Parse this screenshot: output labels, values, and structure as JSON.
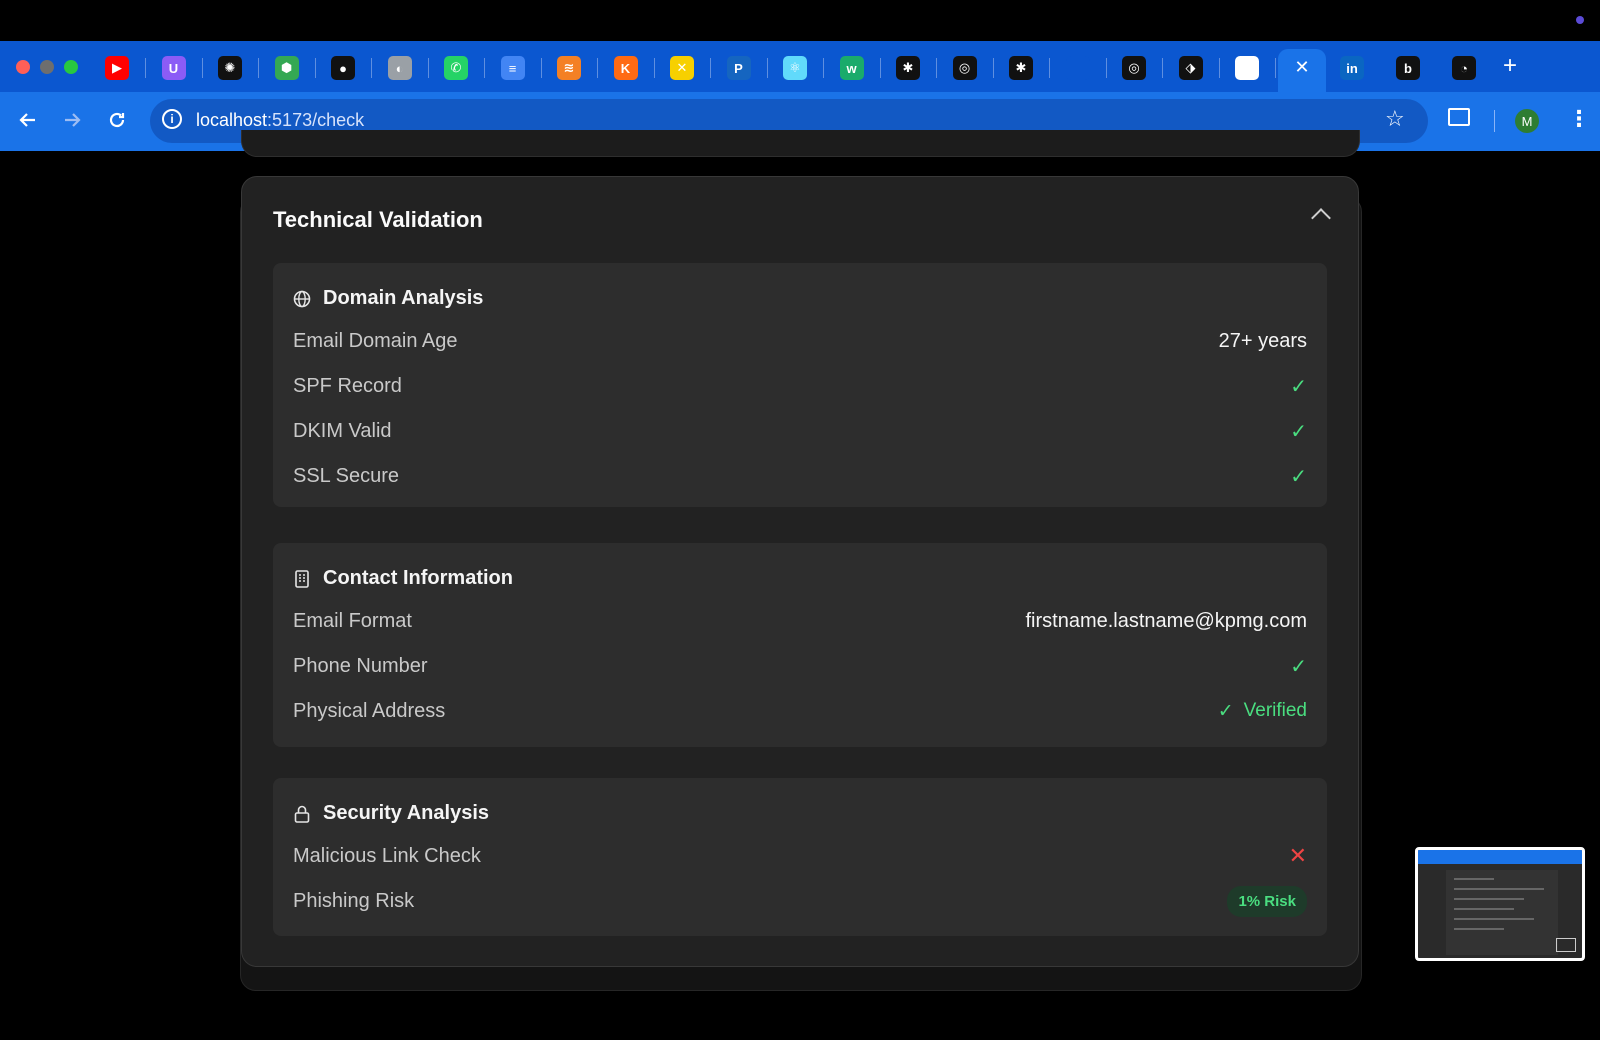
{
  "browser": {
    "active_tab_close": "✕",
    "new_tab": "+",
    "url_host": "localhost",
    "url_path": ":5173/check",
    "avatar_initial": "M",
    "tab_icons": [
      {
        "name": "youtube-icon",
        "glyph": "▶",
        "color": "#ff0000"
      },
      {
        "name": "u-app-icon",
        "glyph": "U",
        "color": "#8b5cf6"
      },
      {
        "name": "openai-icon",
        "glyph": "✺",
        "color": "#111111"
      },
      {
        "name": "cube-icon",
        "glyph": "⬢",
        "color": "#34a853"
      },
      {
        "name": "github-icon",
        "glyph": "●",
        "color": "#111111"
      },
      {
        "name": "globe-icon",
        "glyph": "◐",
        "color": "#9aa0a6"
      },
      {
        "name": "whatsapp-icon",
        "glyph": "✆",
        "color": "#25d366"
      },
      {
        "name": "docs-icon",
        "glyph": "≡",
        "color": "#4285f4"
      },
      {
        "name": "stack-icon",
        "glyph": "≋",
        "color": "#f48024"
      },
      {
        "name": "k-app-icon",
        "glyph": "K",
        "color": "#ff6a13"
      },
      {
        "name": "yellow-app-icon",
        "glyph": "✕",
        "color": "#f7d000"
      },
      {
        "name": "p-app-icon",
        "glyph": "P",
        "color": "#1565c0"
      },
      {
        "name": "react-icon",
        "glyph": "⚛",
        "color": "#61dafb"
      },
      {
        "name": "w-app-icon",
        "glyph": "w",
        "color": "#1aab6b"
      },
      {
        "name": "perplexity-icon",
        "glyph": "✱",
        "color": "#111111"
      },
      {
        "name": "ring-icon",
        "glyph": "◎",
        "color": "#111111"
      },
      {
        "name": "perplexity-icon-2",
        "glyph": "✱",
        "color": "#111111"
      },
      {
        "name": "blank-tab-icon",
        "glyph": "",
        "color": "#0b57d0"
      },
      {
        "name": "ring-icon-2",
        "glyph": "◎",
        "color": "#111111"
      },
      {
        "name": "shirt-app-icon",
        "glyph": "⬗",
        "color": "#111111"
      },
      {
        "name": "chrome-icon",
        "glyph": "◉",
        "color": "#ffffff"
      }
    ],
    "tab_icons_right": [
      {
        "name": "linkedin-icon",
        "glyph": "in",
        "color": "#0a66c2"
      },
      {
        "name": "b-app-icon",
        "glyph": "b",
        "color": "#111111"
      },
      {
        "name": "swirl-app-icon",
        "glyph": "◔",
        "color": "#111111"
      }
    ]
  },
  "card": {
    "title": "Technical Validation",
    "sections": [
      {
        "title": "Domain Analysis",
        "icon": "globe-icon",
        "rows": [
          {
            "label": "Email Domain Age",
            "value": "27+ years"
          },
          {
            "label": "SPF Record",
            "value": "✓"
          },
          {
            "label": "DKIM Valid",
            "value": "✓"
          },
          {
            "label": "SSL Secure",
            "value": "✓"
          }
        ]
      },
      {
        "title": "Contact Information",
        "icon": "building-icon",
        "rows": [
          {
            "label": "Email Format",
            "value": "firstname.lastname@kpmg.com"
          },
          {
            "label": "Phone Number",
            "value": "✓"
          },
          {
            "label": "Physical Address",
            "value": "Verified",
            "check": "✓"
          }
        ]
      },
      {
        "title": "Security Analysis",
        "icon": "lock-icon",
        "rows": [
          {
            "label": "Malicious Link Check",
            "value": "✕"
          },
          {
            "label": "Phishing Risk",
            "value": "1% Risk"
          }
        ]
      }
    ]
  },
  "colors": {
    "accent_green": "#4ade80",
    "danger_red": "#ef4444",
    "chrome_blue": "#1a73e8"
  }
}
